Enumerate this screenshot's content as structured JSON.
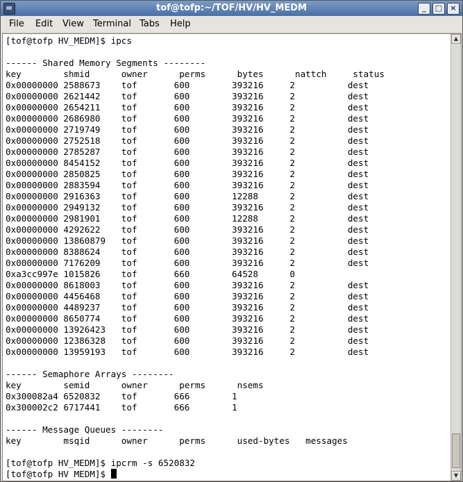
{
  "window": {
    "title": "tof@tofp:~/TOF/HV/HV_MEDM"
  },
  "menubar": {
    "file": "File",
    "edit": "Edit",
    "view": "View",
    "terminal": "Terminal",
    "tabs": "Tabs",
    "help": "Help"
  },
  "terminal": {
    "lines": [
      "[tof@tofp HV_MEDM]$ ipcs",
      "",
      "------ Shared Memory Segments --------",
      "key        shmid      owner      perms      bytes      nattch     status",
      "0x00000000 2588673    tof       600        393216     2          dest",
      "0x00000000 2621442    tof       600        393216     2          dest",
      "0x00000000 2654211    tof       600        393216     2          dest",
      "0x00000000 2686980    tof       600        393216     2          dest",
      "0x00000000 2719749    tof       600        393216     2          dest",
      "0x00000000 2752518    tof       600        393216     2          dest",
      "0x00000000 2785287    tof       600        393216     2          dest",
      "0x00000000 8454152    tof       600        393216     2          dest",
      "0x00000000 2850825    tof       600        393216     2          dest",
      "0x00000000 2883594    tof       600        393216     2          dest",
      "0x00000000 2916363    tof       600        12288      2          dest",
      "0x00000000 2949132    tof       600        393216     2          dest",
      "0x00000000 2981901    tof       600        12288      2          dest",
      "0x00000000 4292622    tof       600        393216     2          dest",
      "0x00000000 13860879   tof       600        393216     2          dest",
      "0x00000000 8388624    tof       600        393216     2          dest",
      "0x00000000 7176209    tof       600        393216     2          dest",
      "0xa3cc997e 1015826    tof       660        64528      0",
      "0x00000000 8618003    tof       600        393216     2          dest",
      "0x00000000 4456468    tof       600        393216     2          dest",
      "0x00000000 4489237    tof       600        393216     2          dest",
      "0x00000000 8650774    tof       600        393216     2          dest",
      "0x00000000 13926423   tof       600        393216     2          dest",
      "0x00000000 12386328   tof       600        393216     2          dest",
      "0x00000000 13959193   tof       600        393216     2          dest",
      "",
      "------ Semaphore Arrays --------",
      "key        semid      owner      perms      nsems",
      "0x300082a4 6520832    tof       666        1",
      "0x300002c2 6717441    tof       666        1",
      "",
      "------ Message Queues --------",
      "key        msqid      owner      perms      used-bytes   messages",
      "",
      "[tof@tofp HV_MEDM]$ ipcrm -s 6520832",
      "[tof@tofp HV_MEDM]$ "
    ]
  }
}
